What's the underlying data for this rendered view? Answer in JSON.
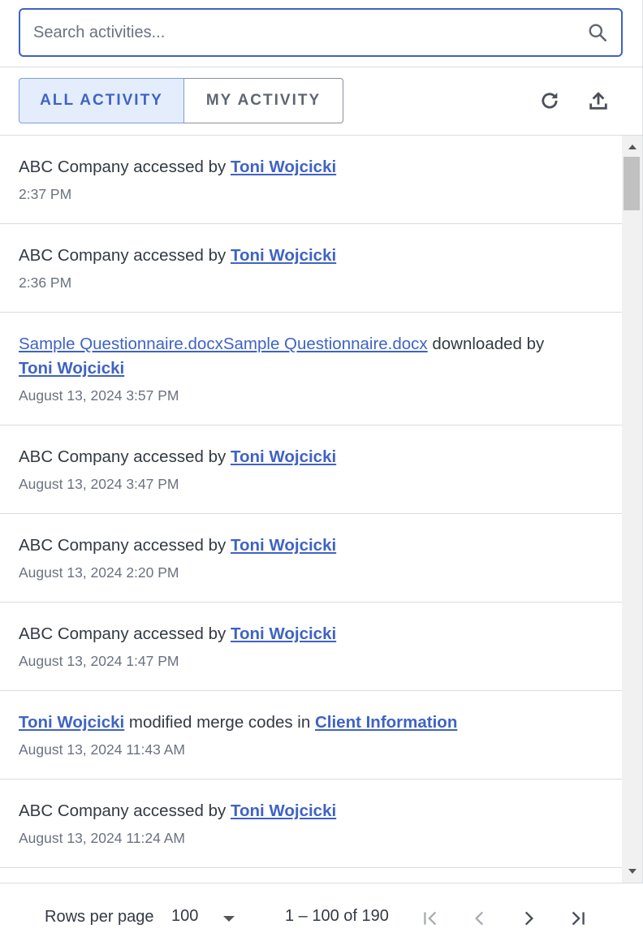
{
  "search": {
    "placeholder": "Search activities...",
    "value": ""
  },
  "tabs": [
    {
      "label": "ALL ACTIVITY",
      "active": true
    },
    {
      "label": "MY ACTIVITY",
      "active": false
    }
  ],
  "toolbar": {
    "refresh_icon": "refresh-icon",
    "export_icon": "upload-icon"
  },
  "activities": [
    {
      "prefix": "ABC Company accessed by ",
      "user": "Toni Wojcicki",
      "time": "2:37 PM"
    },
    {
      "prefix": "ABC Company accessed by ",
      "user": "Toni Wojcicki",
      "time": "2:36 PM"
    },
    {
      "doc": "Sample Questionnaire.docxSample Questionnaire.docx",
      "action": " downloaded by",
      "user": "Toni Wojcicki",
      "time": "August 13, 2024 3:57 PM"
    },
    {
      "prefix": "ABC Company accessed by ",
      "user": "Toni Wojcicki",
      "time": "August 13, 2024 3:47 PM"
    },
    {
      "prefix": "ABC Company accessed by ",
      "user": "Toni Wojcicki",
      "time": "August 13, 2024 2:20 PM"
    },
    {
      "prefix": "ABC Company accessed by ",
      "user": "Toni Wojcicki",
      "time": "August 13, 2024 1:47 PM"
    },
    {
      "user": "Toni Wojcicki",
      "middle": " modified merge codes in ",
      "target": "Client Information",
      "time": "August 13, 2024 11:43 AM"
    },
    {
      "prefix": "ABC Company accessed by ",
      "user": "Toni Wojcicki",
      "time": "August 13, 2024 11:24 AM"
    }
  ],
  "pagination": {
    "rows_per_page_label": "Rows per page",
    "rows_per_page_value": "100",
    "range": "1 – 100 of 190"
  },
  "colors": {
    "accent": "#3f63c4",
    "tab_active_bg": "#e4edfb"
  }
}
